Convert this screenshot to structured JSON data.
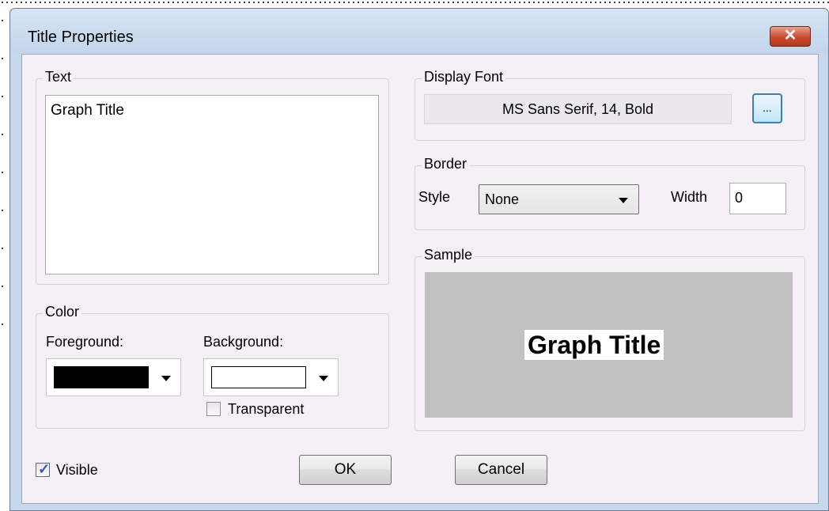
{
  "window": {
    "title": "Title Properties",
    "close_glyph": "✕"
  },
  "text_group": {
    "legend": "Text",
    "value": "Graph Title"
  },
  "color_group": {
    "legend": "Color",
    "foreground_label": "Foreground:",
    "background_label": "Background:",
    "foreground_color": "#000000",
    "background_color": "#ffffff",
    "transparent_label": "Transparent",
    "transparent_checked": false
  },
  "font_group": {
    "legend": "Display Font",
    "value": "MS Sans Serif, 14, Bold",
    "browse_label": "..."
  },
  "border_group": {
    "legend": "Border",
    "style_label": "Style",
    "style_value": "None",
    "width_label": "Width",
    "width_value": "0"
  },
  "sample_group": {
    "legend": "Sample",
    "sample_text": "Graph Title",
    "sample_bg": "#c0c0c0"
  },
  "footer": {
    "visible_label": "Visible",
    "visible_checked": true,
    "ok_label": "OK",
    "cancel_label": "Cancel"
  }
}
